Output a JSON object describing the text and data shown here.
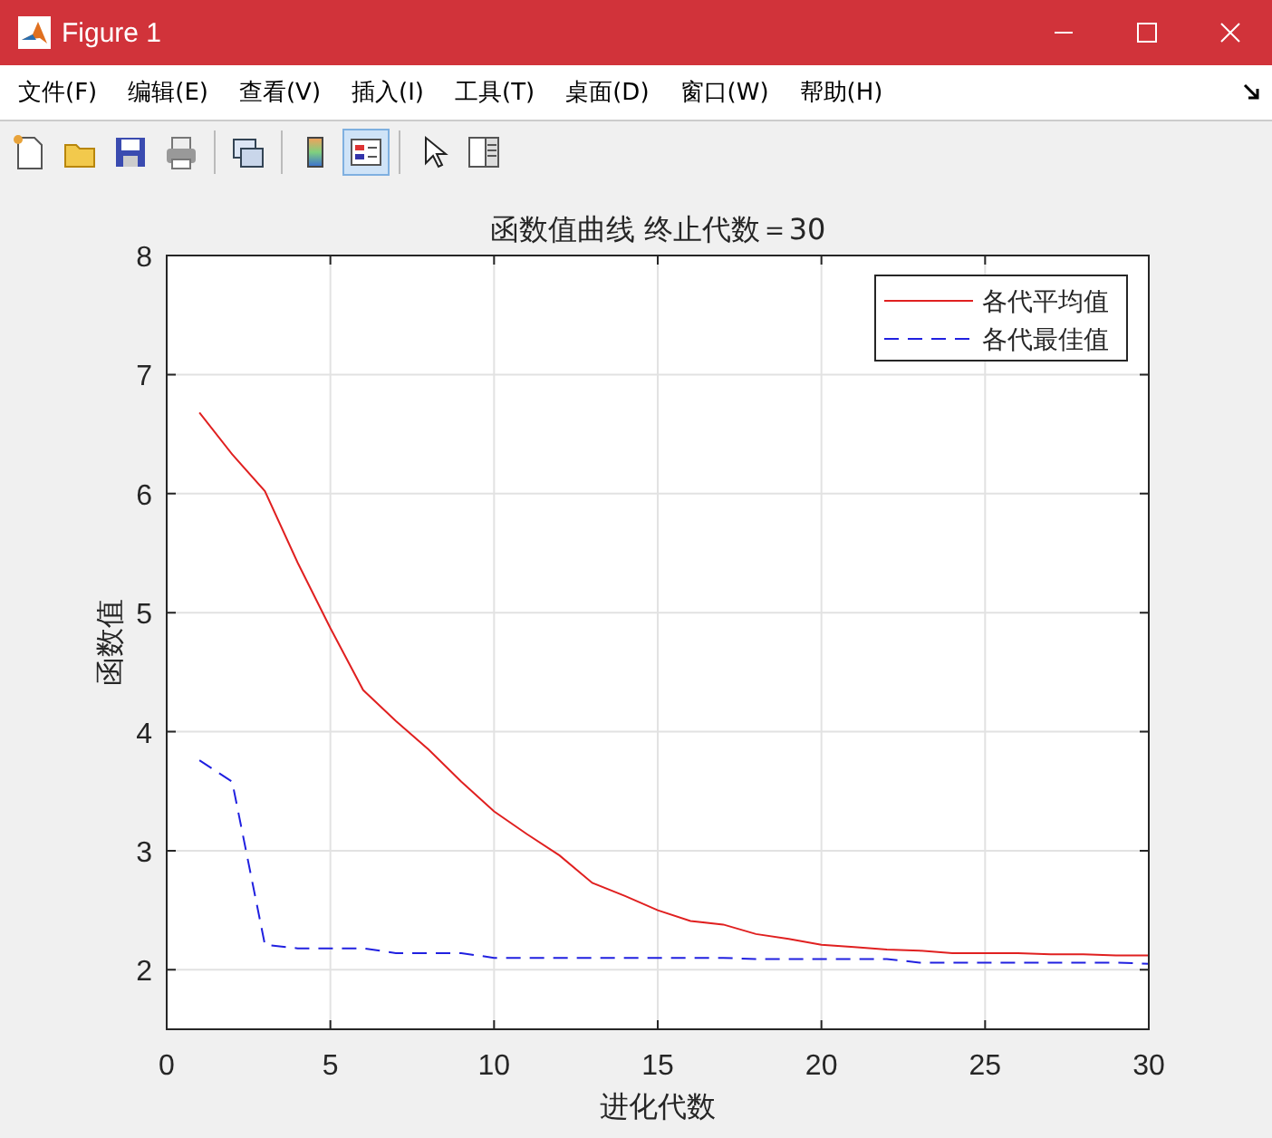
{
  "window": {
    "title": "Figure 1"
  },
  "menu": [
    "文件(F)",
    "编辑(E)",
    "查看(V)",
    "插入(I)",
    "工具(T)",
    "桌面(D)",
    "窗口(W)",
    "帮助(H)"
  ],
  "toolbar": [
    {
      "kind": "new",
      "selected": false
    },
    {
      "kind": "open",
      "selected": false
    },
    {
      "kind": "save",
      "selected": false
    },
    {
      "kind": "print",
      "selected": false
    },
    {
      "kind": "sep"
    },
    {
      "kind": "link",
      "selected": false
    },
    {
      "kind": "sep"
    },
    {
      "kind": "colorbar",
      "selected": false
    },
    {
      "kind": "legend",
      "selected": true
    },
    {
      "kind": "sep"
    },
    {
      "kind": "pointer",
      "selected": false
    },
    {
      "kind": "panel",
      "selected": false
    }
  ],
  "chart_data": {
    "type": "line",
    "title": "函数值曲线  终止代数＝30",
    "xlabel": "进化代数",
    "ylabel": "函数值",
    "x": [
      1,
      2,
      3,
      4,
      5,
      6,
      7,
      8,
      9,
      10,
      11,
      12,
      13,
      14,
      15,
      16,
      17,
      18,
      19,
      20,
      21,
      22,
      23,
      24,
      25,
      26,
      27,
      28,
      29,
      30
    ],
    "series": [
      {
        "name": "各代平均值",
        "color": "#e02020",
        "line_style": "solid",
        "values": [
          6.68,
          6.33,
          6.02,
          5.42,
          4.87,
          4.35,
          4.09,
          3.85,
          3.58,
          3.33,
          3.14,
          2.96,
          2.73,
          2.62,
          2.5,
          2.41,
          2.38,
          2.3,
          2.26,
          2.21,
          2.19,
          2.17,
          2.16,
          2.14,
          2.14,
          2.14,
          2.13,
          2.13,
          2.12,
          2.12
        ]
      },
      {
        "name": "各代最佳值",
        "color": "#2020e0",
        "line_style": "dashed",
        "values": [
          3.76,
          3.58,
          2.21,
          2.18,
          2.18,
          2.18,
          2.14,
          2.14,
          2.14,
          2.1,
          2.1,
          2.1,
          2.1,
          2.1,
          2.1,
          2.1,
          2.1,
          2.09,
          2.09,
          2.09,
          2.09,
          2.09,
          2.06,
          2.06,
          2.06,
          2.06,
          2.06,
          2.06,
          2.06,
          2.05
        ]
      }
    ],
    "grid": true,
    "legend": true,
    "xlim": [
      0,
      30
    ],
    "ylim": [
      1.5,
      8
    ],
    "xticks": [
      0,
      5,
      10,
      15,
      20,
      25,
      30
    ],
    "yticks": [
      2,
      3,
      4,
      5,
      6,
      7,
      8
    ]
  }
}
